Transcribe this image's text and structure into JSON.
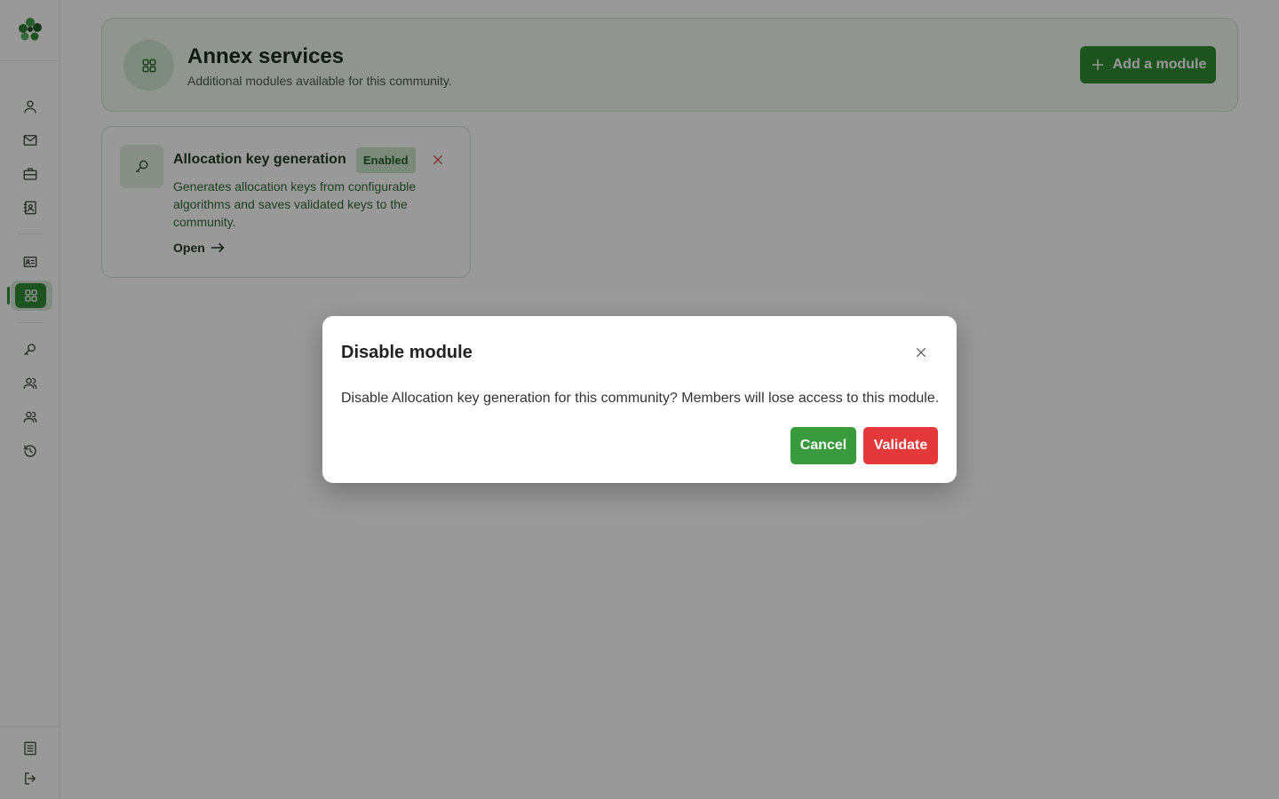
{
  "sidebar": {
    "logo": "clover-logo",
    "items": [
      {
        "icon": "user-icon"
      },
      {
        "icon": "mail-icon"
      },
      {
        "icon": "briefcase-icon"
      },
      {
        "icon": "contact-book-icon"
      },
      {
        "icon": "id-card-icon"
      },
      {
        "icon": "grid-icon",
        "active": true
      },
      {
        "icon": "key-icon"
      },
      {
        "icon": "users-icon"
      },
      {
        "icon": "group-icon"
      },
      {
        "icon": "history-icon"
      },
      {
        "icon": "document-icon"
      },
      {
        "icon": "logout-icon"
      }
    ]
  },
  "header": {
    "title": "Annex services",
    "subtitle": "Additional modules available for this community.",
    "add_button_label": "Add a module"
  },
  "module": {
    "title": "Allocation key generation",
    "status": "Enabled",
    "description": "Generates allocation keys from configurable algorithms and saves validated keys to the community.",
    "open_label": "Open"
  },
  "dialog": {
    "title": "Disable module",
    "message": "Disable Allocation key generation for this community? Members will lose access to this module.",
    "cancel_label": "Cancel",
    "validate_label": "Validate"
  },
  "colors": {
    "accent": "#2f8a35",
    "danger": "#e5383b",
    "badge_bg": "#cde7cd"
  }
}
